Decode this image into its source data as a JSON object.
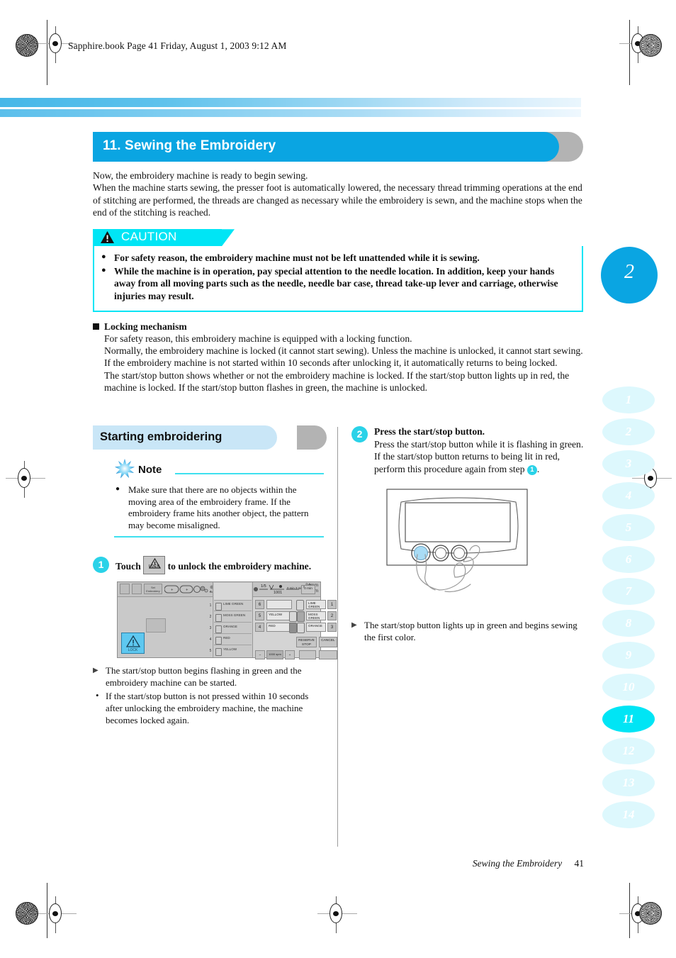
{
  "header": {
    "book_line": "Sapphire.book  Page 41  Friday, August 1, 2003  9:12 AM"
  },
  "section": {
    "number_title": "11. Sewing the Embroidery",
    "intro_line1": "Now, the embroidery machine is ready to begin sewing.",
    "intro_line2": "When the machine starts sewing, the presser foot is automatically lowered, the necessary thread trimming operations at the end of stitching are performed, the threads are changed as necessary while the embroidery is sewn, and the machine stops when the end of the stitching is reached."
  },
  "caution": {
    "label": "CAUTION",
    "items": [
      "For safety reason, the embroidery machine must not be left unattended while it is sewing.",
      "While the machine is in operation, pay special attention to the needle location. In addition, keep your hands away from all moving parts such as the needle, needle bar case, thread take-up lever and carriage, otherwise injuries may result."
    ]
  },
  "locking": {
    "heading": "Locking mechanism",
    "p1": "For safety reason, this embroidery machine is equipped with a locking function.",
    "p2": "Normally, the embroidery machine is locked (it cannot start sewing). Unless the machine is unlocked, it cannot start sewing. If the embroidery machine is not started within 10 seconds after unlocking it, it automatically returns to being locked.",
    "p3": "The start/stop button shows whether or not the embroidery machine is locked. If the start/stop button lights up in red, the machine is locked. If the start/stop button flashes in green, the machine is unlocked."
  },
  "starting": {
    "heading": "Starting embroidering",
    "note": {
      "label": "Note",
      "items": [
        "Make sure that there are no objects within the moving area of the embroidery frame. If the embroidery frame hits another object, the pattern may become misaligned."
      ]
    },
    "step1": {
      "number": "1",
      "text_before": "Touch",
      "key_label": "LOCK",
      "text_after": "to unlock the embroidery machine.",
      "results": [
        "The start/stop button begins flashing in green and the embroidery machine can be started.",
        "If the start/stop button is not pressed within 10 seconds after unlocking the embroidery machine, the machine becomes locked again."
      ]
    },
    "step2": {
      "number": "2",
      "title": "Press the start/stop button.",
      "body_a": "Press the start/stop button while it is flashing in green. If the start/stop button returns to being lit in red, perform this procedure again from step",
      "body_ref": "1",
      "body_b": ".",
      "results": [
        "The start/stop button lights up in green and begins sewing the first color."
      ]
    }
  },
  "lcd": {
    "dimensions": {
      "width": "24mm",
      "height": "37mm"
    },
    "toolbar_label": "Set Embroidery",
    "lock_key_label": "LOCK",
    "color_sequence": [
      "LIME GREEN",
      "MOSS GREEN",
      "ORANGE",
      "RED",
      "YELLOW"
    ],
    "row_numbers": [
      "1",
      "2",
      "3",
      "4",
      "5"
    ],
    "needle_rows": [
      {
        "needle": "6",
        "thread": "",
        "bar_color": "LIME GREEN",
        "bar_number": "1"
      },
      {
        "needle": "5",
        "thread": "YELLOW",
        "bar_color": "MOSS GREEN",
        "bar_number": "2"
      },
      {
        "needle": "4",
        "thread": "RED",
        "bar_color": "ORANGE",
        "bar_number": "3"
      }
    ],
    "top_values": {
      "stitch": "1/5",
      "count": "1001",
      "time_a": "0 min 3 min",
      "time_b": "0 min"
    },
    "buttons": {
      "reserve_stop": "RESERVE STOP",
      "cancel": "CANCEL",
      "minus": "−",
      "plus": "+",
      "speed": "1000 spm"
    }
  },
  "sidebar": {
    "big_number": "2",
    "chapters": [
      "1",
      "2",
      "3",
      "4",
      "5",
      "6",
      "7",
      "8",
      "9",
      "10",
      "11",
      "12",
      "13",
      "14"
    ],
    "active_chapter": "11"
  },
  "footer": {
    "title": "Sewing the Embroidery",
    "page": "41"
  },
  "colors": {
    "section_blue": "#0aa5e2",
    "caution_cyan": "#00e5f5",
    "step_circle": "#2ad2e8",
    "note_rule": "#3ee0ef",
    "subbar_blue": "#c9e6f7",
    "tab_inactive": "#ddf8fd"
  }
}
